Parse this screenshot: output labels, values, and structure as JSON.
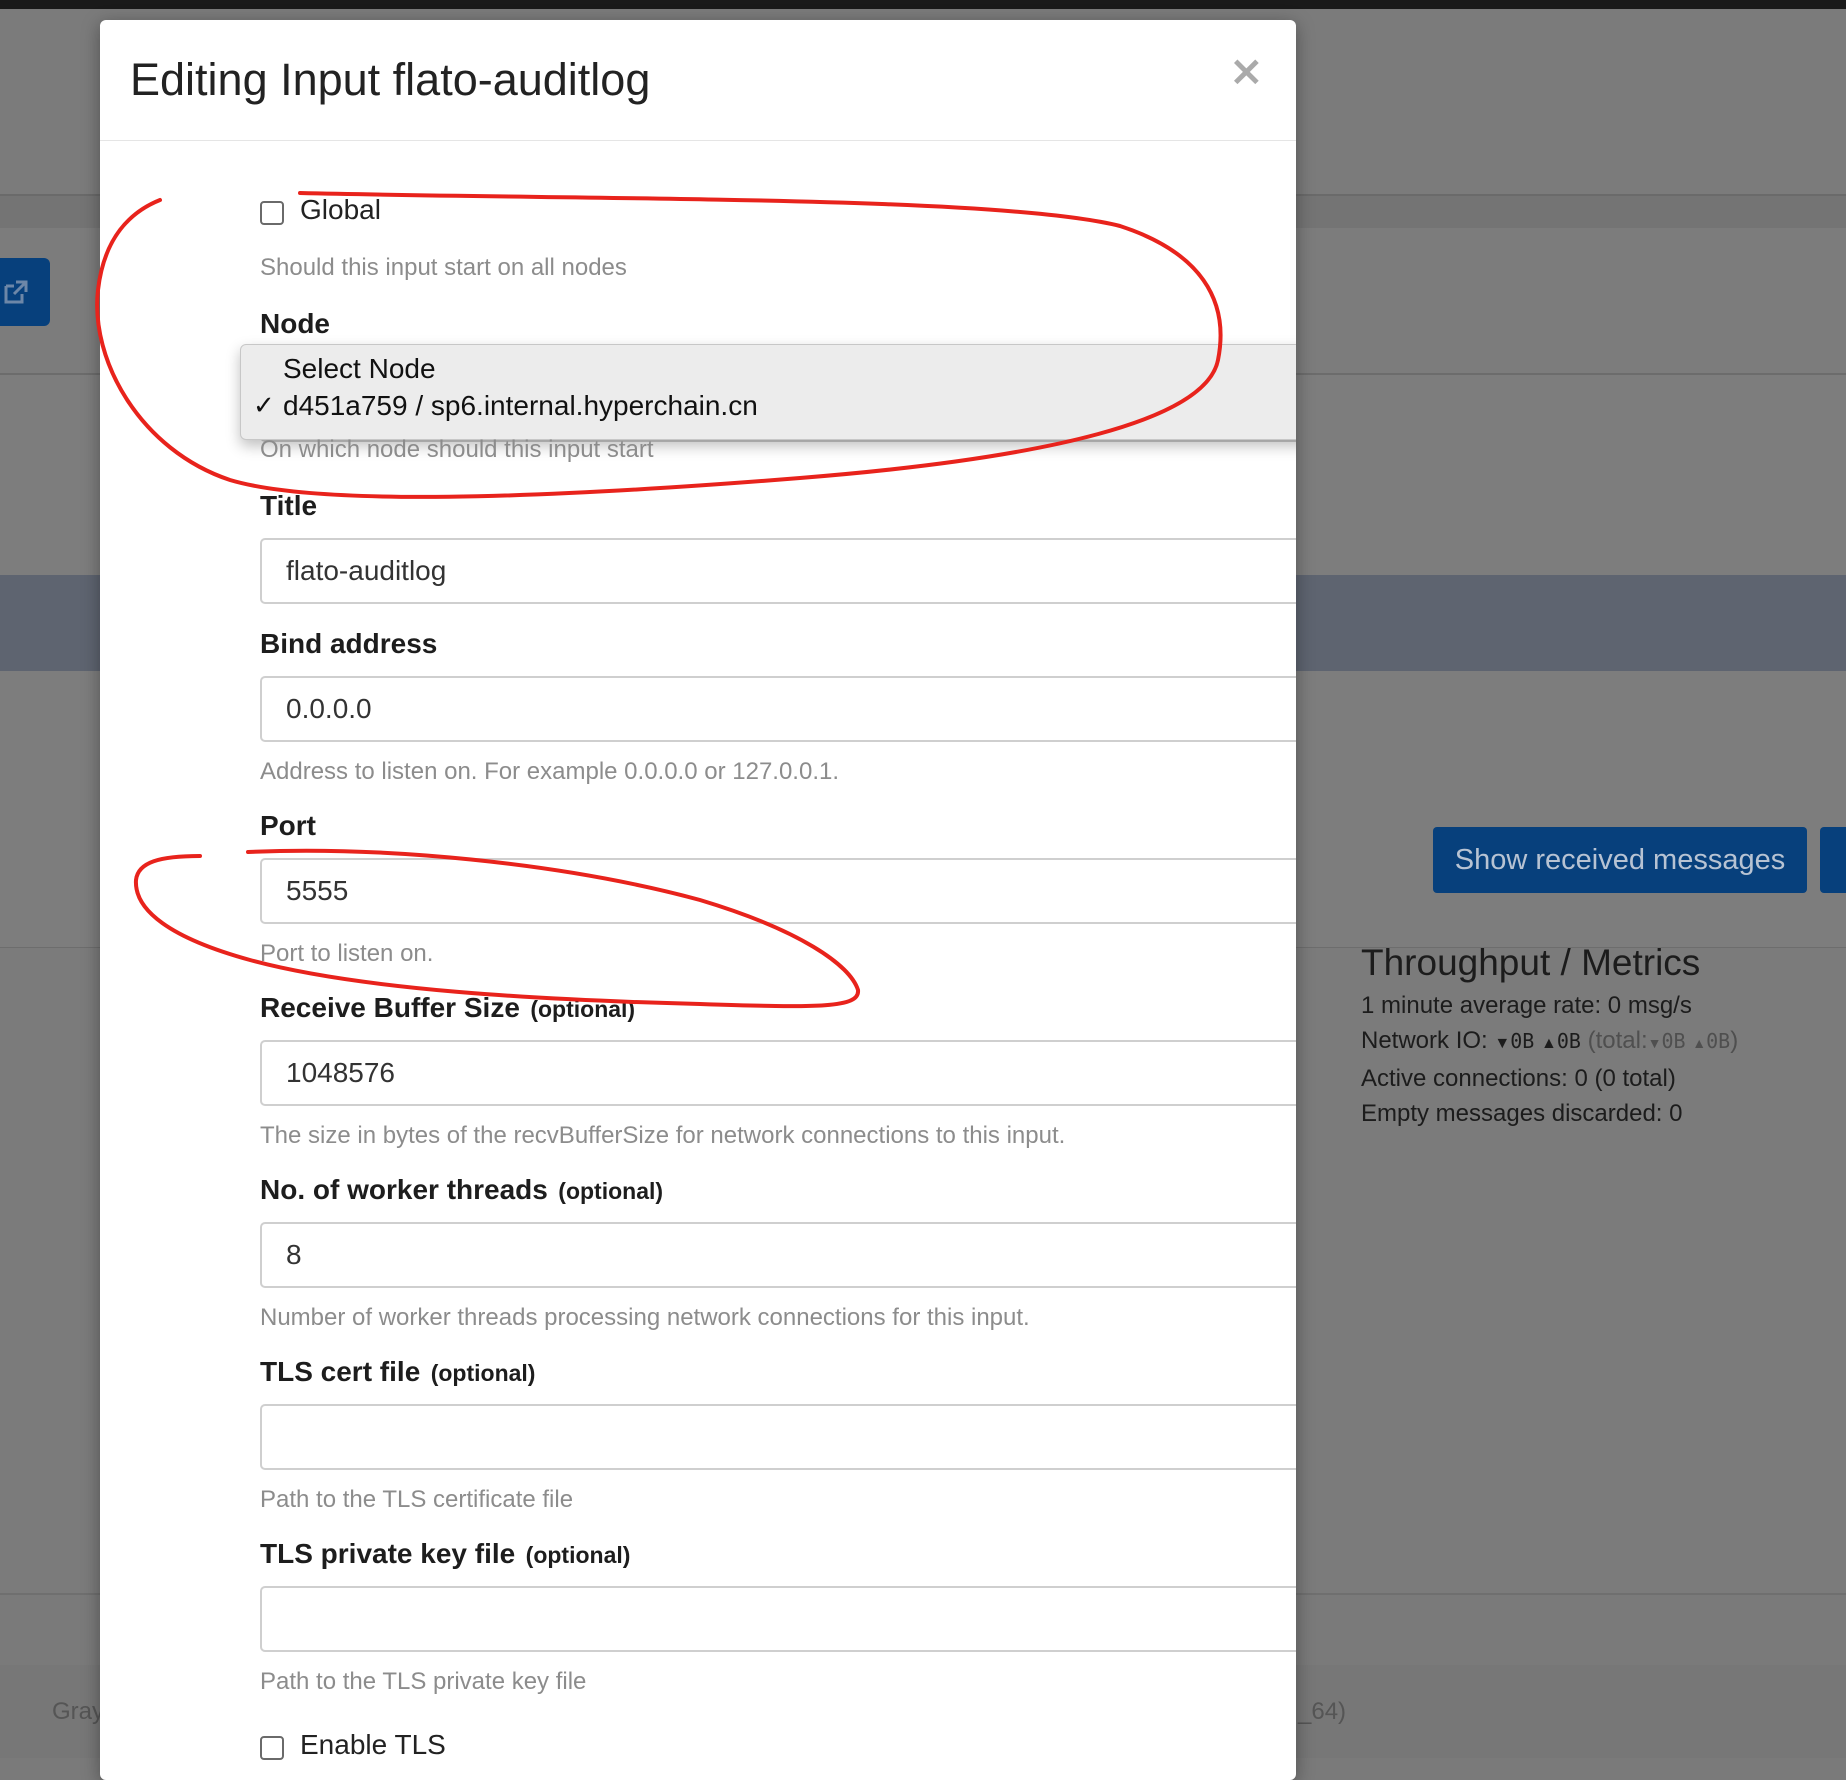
{
  "background": {
    "show_messages_button": "Show received messages",
    "metrics": {
      "title": "Throughput / Metrics",
      "avg_rate": "1 minute average rate: 0 msg/s",
      "network_io_label": "Network IO:",
      "io_down": "0B",
      "io_up": "0B",
      "io_total_label": "(total:",
      "io_total_down": "0B",
      "io_total_up": "0B",
      "io_total_close": ")",
      "active_connections": "Active connections: 0 (0 total)",
      "empty_discarded": "Empty messages discarded: 0"
    },
    "footer_left": "Gray",
    "footer_right": "_64)"
  },
  "modal": {
    "title": "Editing Input flato-auditlog",
    "close": "×",
    "global": {
      "label": "Global",
      "checked": false,
      "help": "Should this input start on all nodes"
    },
    "node": {
      "label": "Node",
      "help": "On which node should this input start",
      "options": [
        "Select Node",
        "d451a759 / sp6.internal.hyperchain.cn"
      ],
      "selected_index": 1,
      "check_mark": "✓"
    },
    "title_field": {
      "label": "Title",
      "value": "flato-auditlog"
    },
    "bind_address": {
      "label": "Bind address",
      "value": "0.0.0.0",
      "help": "Address to listen on. For example 0.0.0.0 or 127.0.0.1."
    },
    "port": {
      "label": "Port",
      "value": "5555",
      "help": "Port to listen on."
    },
    "recv_buffer": {
      "label": "Receive Buffer Size",
      "optional": "(optional)",
      "value": "1048576",
      "help": "The size in bytes of the recvBufferSize for network connections to this input."
    },
    "worker_threads": {
      "label": "No. of worker threads",
      "optional": "(optional)",
      "value": "8",
      "help": "Number of worker threads processing network connections for this input."
    },
    "tls_cert": {
      "label": "TLS cert file",
      "optional": "(optional)",
      "value": "",
      "help": "Path to the TLS certificate file"
    },
    "tls_key": {
      "label": "TLS private key file",
      "optional": "(optional)",
      "value": "",
      "help": "Path to the TLS private key file"
    },
    "enable_tls": {
      "label": "Enable TLS",
      "checked": false
    }
  },
  "colors": {
    "annotation": "#e8231c",
    "primary_button": "#07407c",
    "help_text": "#8c8c8c"
  }
}
